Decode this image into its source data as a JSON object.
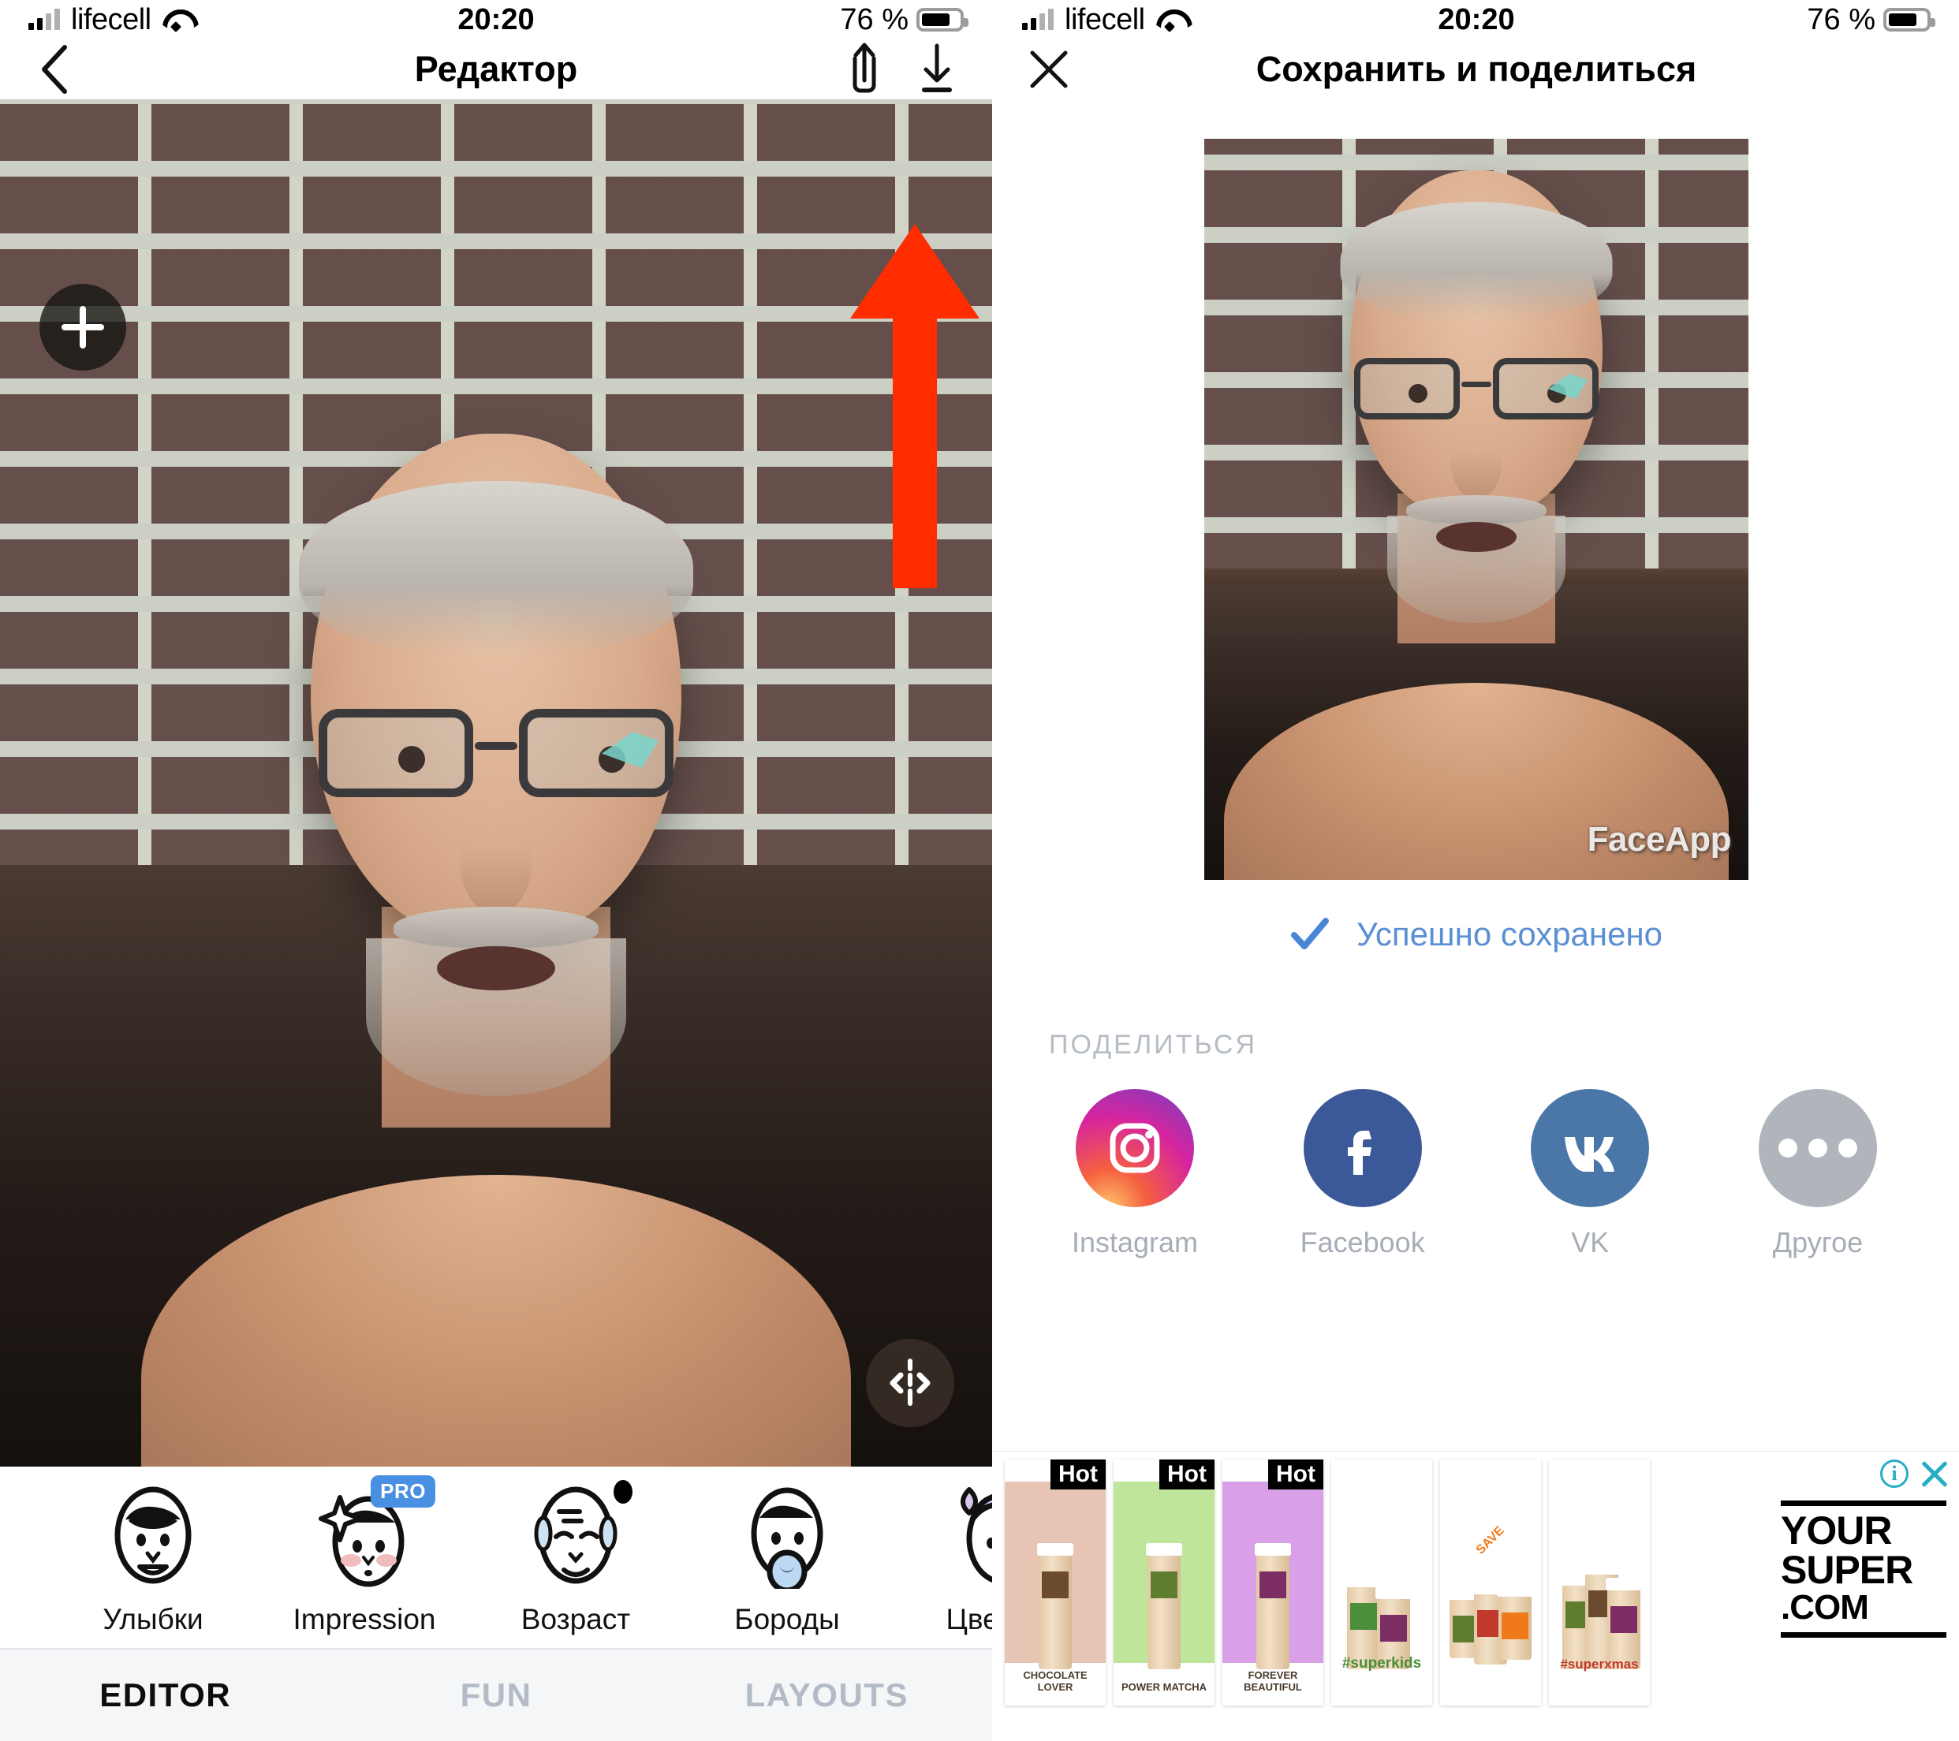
{
  "left_screen": {
    "statusbar": {
      "carrier": "lifecell",
      "time": "20:20",
      "battery_percent": "76 %",
      "wifi_icon": "wifi-icon",
      "signal_icon": "cellular-signal-icon",
      "battery_icon": "battery-icon"
    },
    "navbar": {
      "back_icon": "chevron-left-icon",
      "title": "Редактор",
      "share_icon": "share-upload-icon",
      "download_icon": "download-icon"
    },
    "canvas": {
      "add_button_icon": "plus-icon",
      "compare_handle_icon": "compare-slider-icon",
      "annotation_arrow": {
        "icon": "red-arrow-up-icon",
        "color": "#ff2d00"
      }
    },
    "filters": [
      {
        "label": "Улыбки",
        "icon": "face-smile-icon",
        "badge": ""
      },
      {
        "label": "Impression",
        "icon": "face-impression-icon",
        "badge": "PRO"
      },
      {
        "label": "Возраст",
        "icon": "face-age-icon",
        "badge": "new-dot"
      },
      {
        "label": "Бороды",
        "icon": "face-beard-icon",
        "badge": ""
      },
      {
        "label": "Цвета в",
        "icon": "face-hair-color-icon",
        "badge": ""
      }
    ],
    "tabs": [
      {
        "label": "EDITOR",
        "active": true
      },
      {
        "label": "FUN",
        "active": false
      },
      {
        "label": "LAYOUTS",
        "active": false
      }
    ]
  },
  "right_screen": {
    "statusbar": {
      "carrier": "lifecell",
      "time": "20:20",
      "battery_percent": "76 %",
      "wifi_icon": "wifi-icon",
      "signal_icon": "cellular-signal-icon",
      "battery_icon": "battery-icon"
    },
    "navbar": {
      "close_icon": "close-x-icon",
      "title": "Сохранить и поделиться"
    },
    "preview": {
      "watermark": "FaceApp"
    },
    "saved_status": {
      "icon": "checkmark-icon",
      "text": "Успешно сохранено",
      "color": "#5b8fd4"
    },
    "share": {
      "section_title": "ПОДЕЛИТЬСЯ",
      "items": [
        {
          "label": "Instagram",
          "icon": "instagram-icon",
          "color": "#d6249f"
        },
        {
          "label": "Facebook",
          "icon": "facebook-icon",
          "color": "#3b5998"
        },
        {
          "label": "VK",
          "icon": "vk-icon",
          "color": "#4a76a8"
        },
        {
          "label": "Другое",
          "icon": "more-ellipsis-icon",
          "color": "#b0b4bb"
        }
      ]
    },
    "ad": {
      "info_icon": "ad-info-icon",
      "close_icon": "ad-close-icon",
      "accent_color": "#27aec4",
      "brand": {
        "line1": "YOUR",
        "line2": "SUPER",
        "line3": ".COM"
      },
      "tiles": [
        {
          "badge": "Hot",
          "name": "CHOCOLATE LOVER",
          "tag": "",
          "bg": "#e8c4b4",
          "band": "#6b4a2e"
        },
        {
          "badge": "Hot",
          "name": "POWER MATCHA",
          "tag": "",
          "bg": "#bfe59a",
          "band": "#5f7d2e"
        },
        {
          "badge": "Hot",
          "name": "FOREVER BEAUTIFUL",
          "tag": "",
          "bg": "#d9a0e8",
          "band": "#7c2d64"
        },
        {
          "badge": "",
          "name": "",
          "tag": "#superkids",
          "bg": "#ffffff",
          "band": "#4b8f3a"
        },
        {
          "badge": "",
          "name": "",
          "tag": "SAVE",
          "bg": "#ffffff",
          "band": "#f07a1a"
        },
        {
          "badge": "",
          "name": "",
          "tag": "#superxmas",
          "bg": "#ffffff",
          "band": "#c0392b"
        }
      ]
    }
  }
}
